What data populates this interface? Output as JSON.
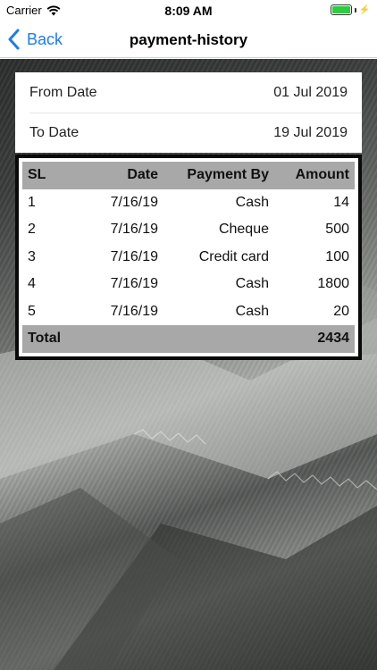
{
  "status_bar": {
    "carrier": "Carrier",
    "time": "8:09 AM",
    "wifi_icon": "wifi-icon",
    "battery_icon": "battery-icon",
    "battery_level": 1.0,
    "charging_icon": "bolt-icon"
  },
  "nav": {
    "back_label": "Back",
    "title": "payment-history",
    "accent_color": "#1a7cf5"
  },
  "date_range": {
    "from_label": "From Date",
    "from_value": "01 Jul 2019",
    "to_label": "To Date",
    "to_value": "19 Jul 2019"
  },
  "table": {
    "headers": [
      "SL",
      "Date",
      "Payment By",
      "Amount"
    ],
    "rows": [
      {
        "sl": "1",
        "date": "7/16/19",
        "payment_by": "Cash",
        "amount": "14"
      },
      {
        "sl": "2",
        "date": "7/16/19",
        "payment_by": "Cheque",
        "amount": "500"
      },
      {
        "sl": "3",
        "date": "7/16/19",
        "payment_by": "Credit card",
        "amount": "100"
      },
      {
        "sl": "4",
        "date": "7/16/19",
        "payment_by": "Cash",
        "amount": "1800"
      },
      {
        "sl": "5",
        "date": "7/16/19",
        "payment_by": "Cash",
        "amount": "20"
      }
    ],
    "total_label": "Total",
    "total_value": "2434",
    "header_bg_color": "#a8a8a8"
  }
}
